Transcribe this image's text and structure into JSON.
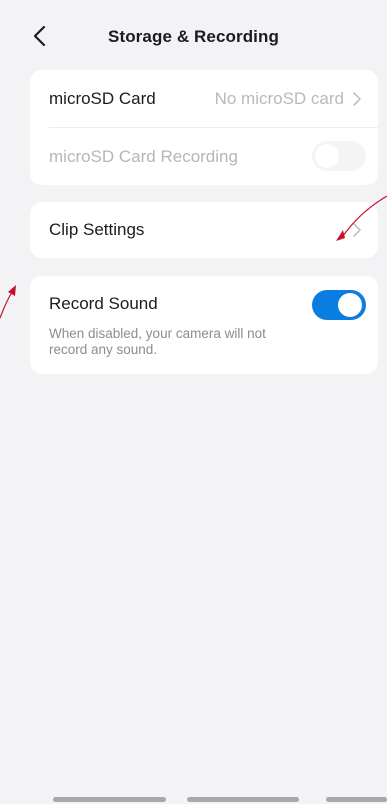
{
  "header": {
    "title": "Storage & Recording"
  },
  "storage": {
    "microsd_label": "microSD Card",
    "microsd_value": "No microSD card",
    "recording_label": "microSD Card Recording",
    "recording_enabled": false
  },
  "clip": {
    "label": "Clip Settings"
  },
  "sound": {
    "label": "Record Sound",
    "description": "When disabled, your camera will not record any sound.",
    "enabled": true
  },
  "colors": {
    "accent": "#0a7ee0",
    "annotation": "#c8102e",
    "background": "#f3f3f5"
  },
  "icons": [
    "back-chevron-icon",
    "chevron-right-icon"
  ]
}
